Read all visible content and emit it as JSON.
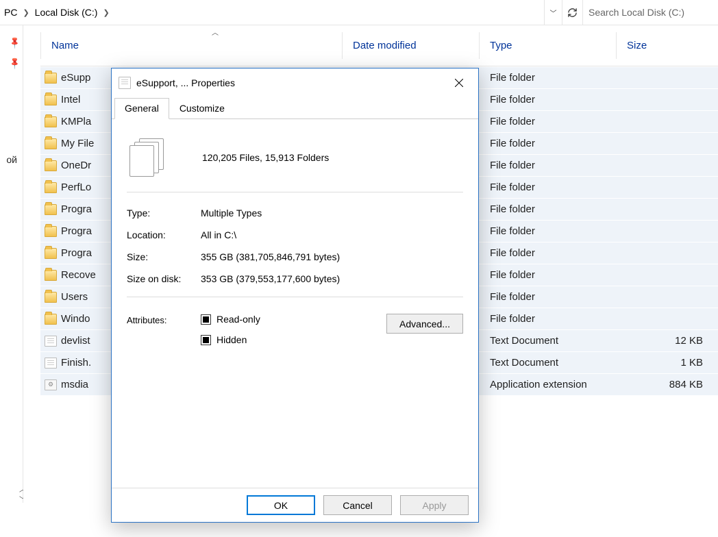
{
  "addressbar": {
    "crumb1": "PC",
    "crumb2": "Local Disk (C:)",
    "search_placeholder": "Search Local Disk (C:)"
  },
  "nav": {
    "item_partial": "ой"
  },
  "columns": {
    "name": "Name",
    "date": "Date modified",
    "type": "Type",
    "size": "Size"
  },
  "rows": [
    {
      "icon": "folder",
      "name": "eSupp",
      "type": "File folder",
      "size": ""
    },
    {
      "icon": "folder",
      "name": "Intel",
      "type": "File folder",
      "size": ""
    },
    {
      "icon": "folder",
      "name": "KMPla",
      "type": "File folder",
      "size": ""
    },
    {
      "icon": "folder",
      "name": "My File",
      "type": "File folder",
      "size": ""
    },
    {
      "icon": "folder",
      "name": "OneDr",
      "type": "File folder",
      "size": ""
    },
    {
      "icon": "folder",
      "name": "PerfLo",
      "type": "File folder",
      "size": ""
    },
    {
      "icon": "folder",
      "name": "Progra",
      "type": "File folder",
      "size": ""
    },
    {
      "icon": "folder",
      "name": "Progra",
      "type": "File folder",
      "size": ""
    },
    {
      "icon": "folder",
      "name": "Progra",
      "type": "File folder",
      "size": ""
    },
    {
      "icon": "folder",
      "name": "Recove",
      "type": "File folder",
      "size": ""
    },
    {
      "icon": "folder",
      "name": "Users",
      "type": "File folder",
      "size": ""
    },
    {
      "icon": "folder",
      "name": "Windo",
      "type": "File folder",
      "size": ""
    },
    {
      "icon": "file",
      "name": "devlist",
      "type": "Text Document",
      "size": "12 KB"
    },
    {
      "icon": "file",
      "name": "Finish.",
      "type": "Text Document",
      "size": "1 KB"
    },
    {
      "icon": "dll",
      "name": "msdia",
      "type": "Application extension",
      "size": "884 KB"
    }
  ],
  "dialog": {
    "title": "eSupport, ... Properties",
    "tab_general": "General",
    "tab_customize": "Customize",
    "summary": "120,205 Files, 15,913 Folders",
    "props": {
      "type_label": "Type:",
      "type_val": "Multiple Types",
      "location_label": "Location:",
      "location_val": "All in C:\\",
      "size_label": "Size:",
      "size_val": "355 GB (381,705,846,791 bytes)",
      "disk_label": "Size on disk:",
      "disk_val": "353 GB (379,553,177,600 bytes)",
      "attr_label": "Attributes:"
    },
    "readonly_label": "Read-only",
    "hidden_label": "Hidden",
    "advanced_label": "Advanced...",
    "ok": "OK",
    "cancel": "Cancel",
    "apply": "Apply"
  }
}
